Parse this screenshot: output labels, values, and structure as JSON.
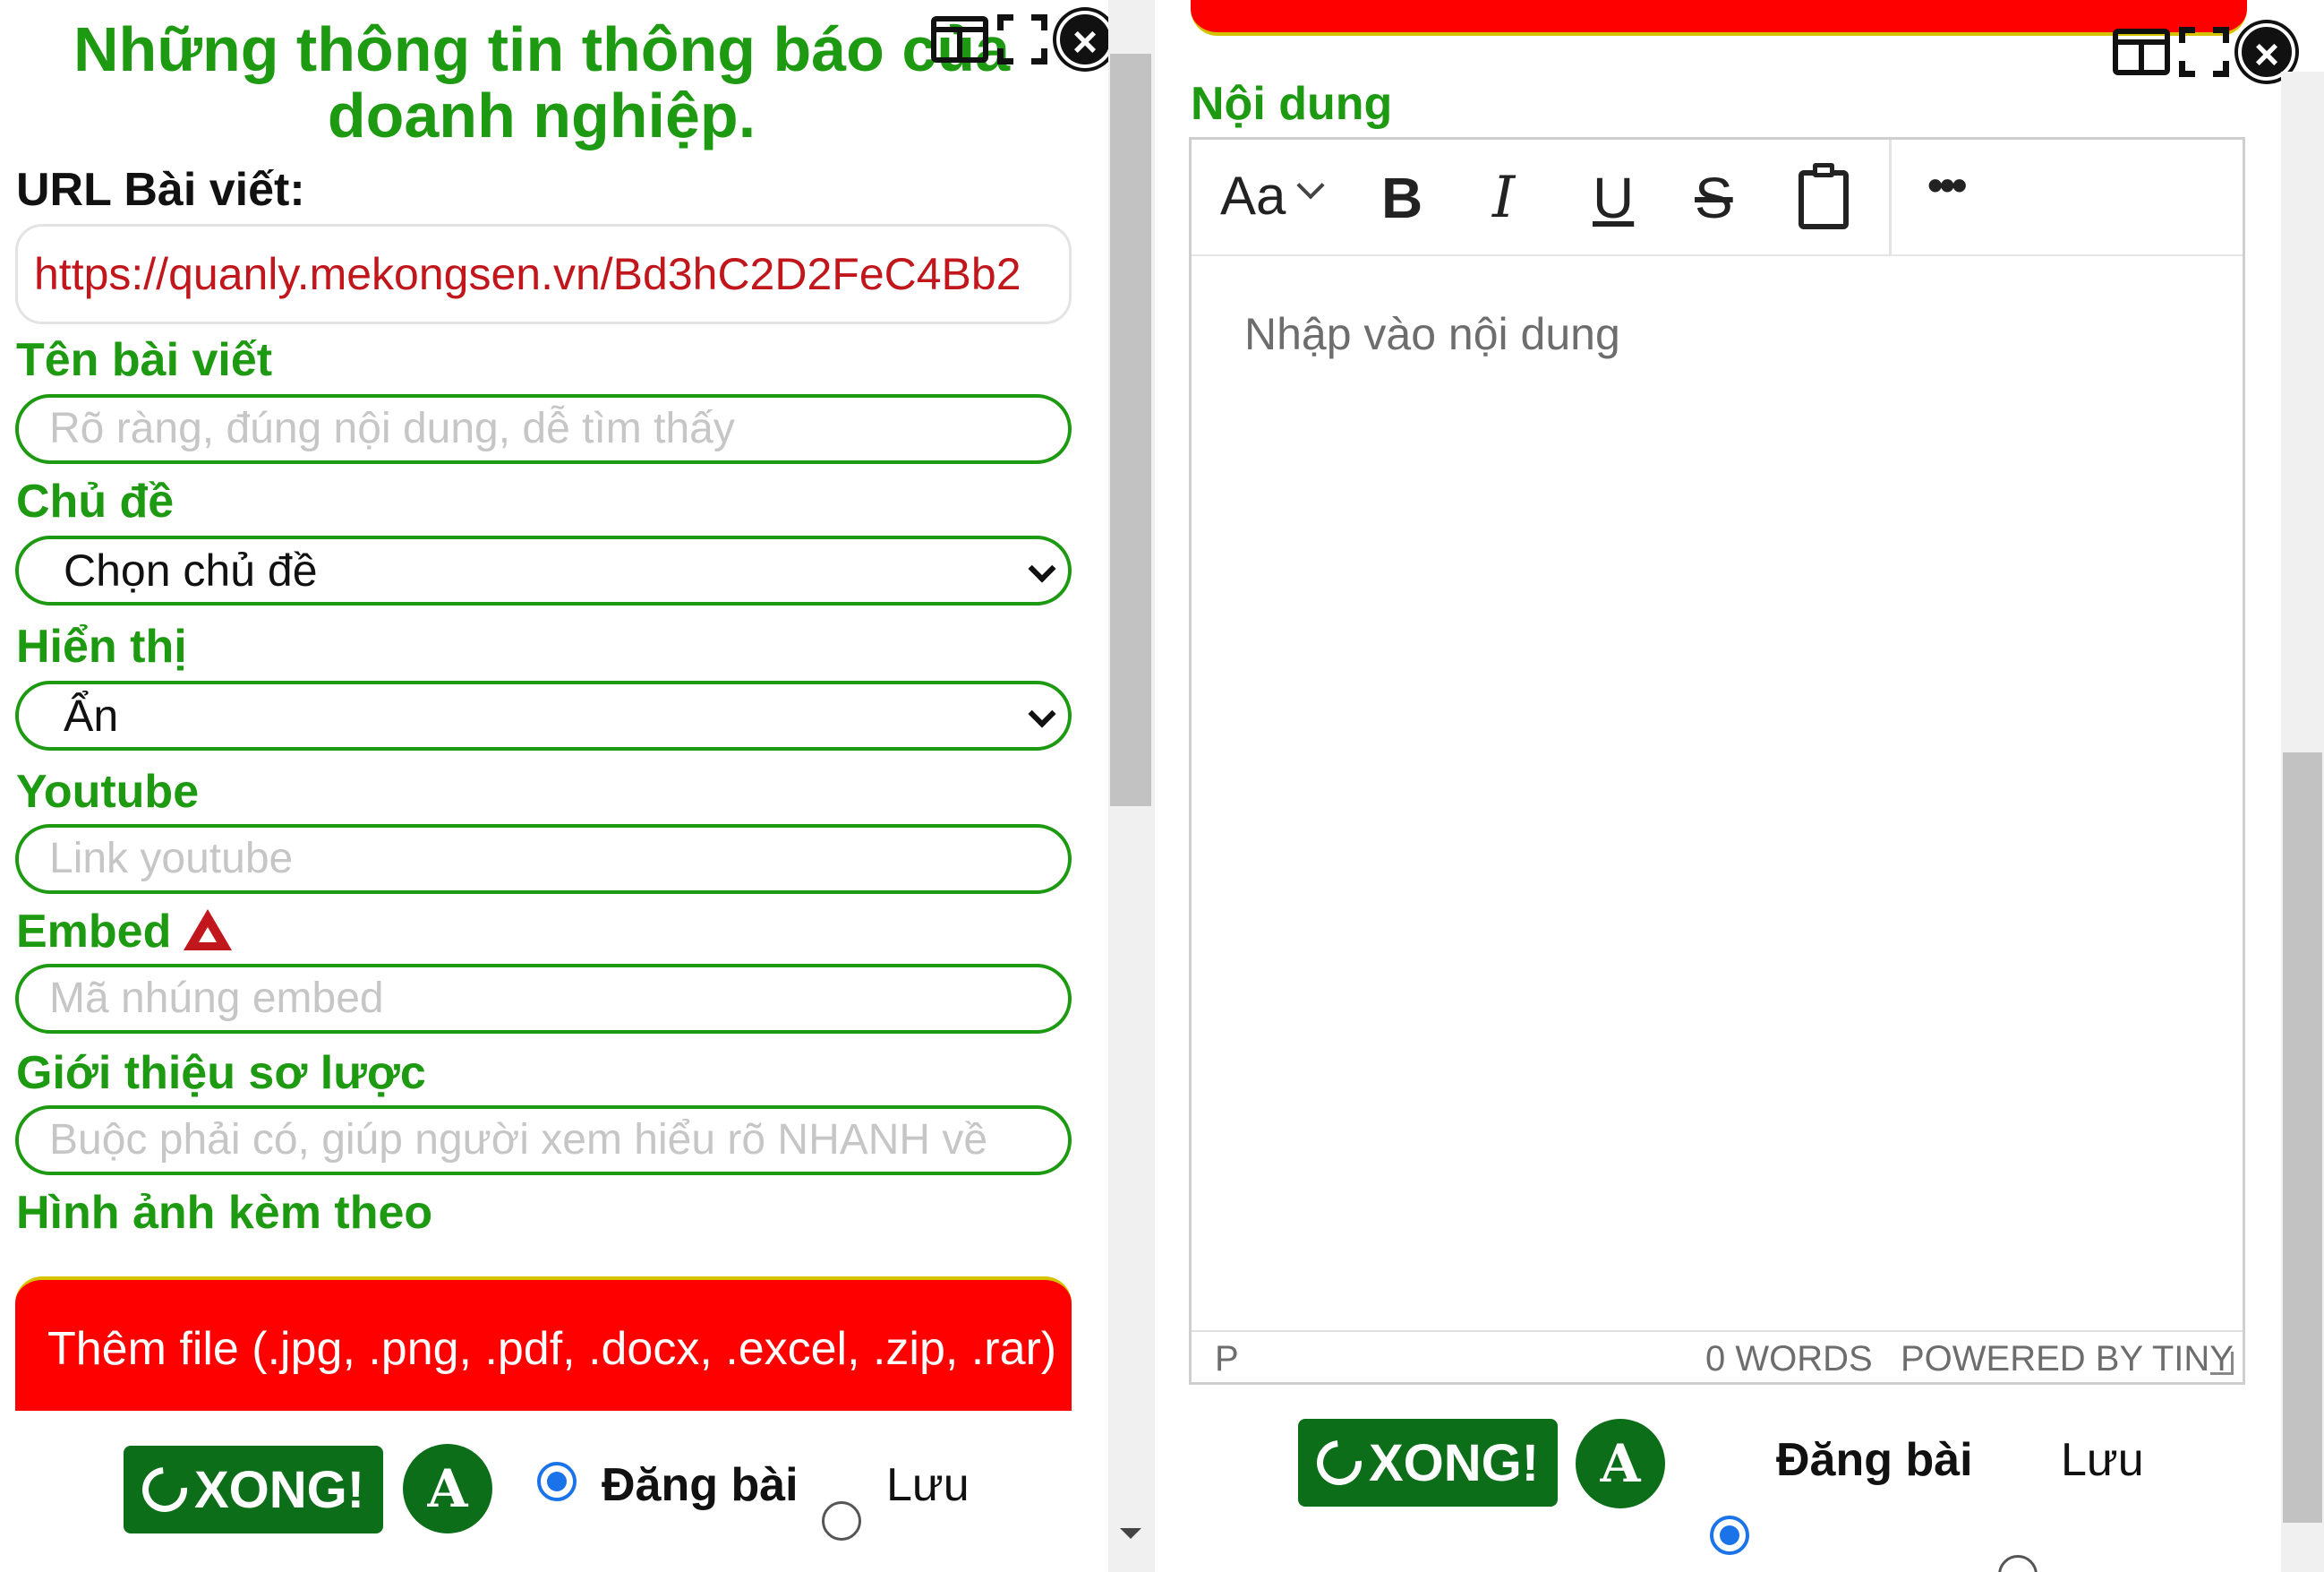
{
  "left_panel": {
    "title": "Những thông tin thông báo của doanh nghiệp.",
    "url_label": "URL Bài viết:",
    "url_value": "https://quanly.mekongsen.vn/Bd3hC2D2FeC4Bb2",
    "title_field": {
      "label": "Tên bài viết",
      "placeholder": "Rõ ràng, đúng nội dung, dễ tìm thấy"
    },
    "topic": {
      "label": "Chủ đề",
      "selected": "Chọn chủ đề"
    },
    "visibility": {
      "label": "Hiển thị",
      "selected": "Ẩn"
    },
    "youtube": {
      "label": "Youtube",
      "placeholder": "Link youtube"
    },
    "embed": {
      "label": "Embed",
      "placeholder": "Mã nhúng embed"
    },
    "summary": {
      "label": "Giới thiệu sơ lược",
      "placeholder": "Buộc phải có, giúp người xem hiểu rõ NHANH về"
    },
    "attachments_label": "Hình ảnh kèm theo",
    "add_file": "Thêm file (.jpg, .png, .pdf, .docx, .excel, .zip, .rar)",
    "done_button": "XONG!",
    "avatar_letter": "A",
    "publish_label": "Đăng bài",
    "save_label": "Lưu"
  },
  "right_panel": {
    "content_label": "Nội dung",
    "toolbar": {
      "font_label": "Aa",
      "bold": "B",
      "italic": "I",
      "underline": "U",
      "strike": "S",
      "more": "•••"
    },
    "placeholder": "Nhập vào nội dung",
    "status_path": "P",
    "word_count": "0 WORDS",
    "powered_by": "POWERED BY TINY",
    "done_button": "XONG!",
    "avatar_letter": "A",
    "publish_label": "Đăng bài",
    "save_label": "Lưu"
  },
  "colors": {
    "label_green": "#1e9a12",
    "button_green": "#0d6e1a",
    "accent_red": "#ff0000",
    "url_red": "#c0161c",
    "radio_blue": "#1a73e8"
  }
}
